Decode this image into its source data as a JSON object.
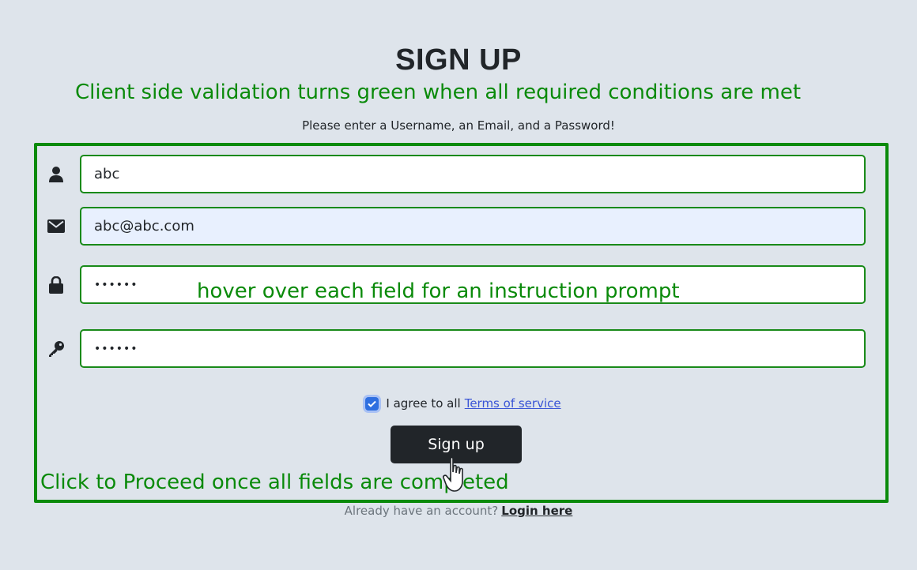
{
  "header": {
    "title": "SIGN UP",
    "subtitle": "Please enter a Username, an Email, and a Password!"
  },
  "annotations": {
    "top": "Client side validation turns green when all required conditions are met",
    "middle": "hover over each field for an instruction prompt",
    "bottom": "Click to Proceed once all fields are completed"
  },
  "form": {
    "username": {
      "value": "abc",
      "icon": "user-icon"
    },
    "email": {
      "value": "abc@abc.com",
      "icon": "envelope-icon"
    },
    "password": {
      "value": "••••••",
      "icon": "lock-icon"
    },
    "confirm_password": {
      "value": "••••••",
      "icon": "key-icon"
    },
    "agree_text": "I agree to all",
    "terms_link": "Terms of service",
    "agree_checked": true,
    "submit_label": "Sign up"
  },
  "footer": {
    "prompt": "Already have an account?",
    "login_link": "Login here"
  },
  "colors": {
    "background": "#dee4eb",
    "validation_green": "#0a8a0a",
    "button": "#212529",
    "link": "#3a55d6",
    "checkbox": "#2f6fe0"
  }
}
